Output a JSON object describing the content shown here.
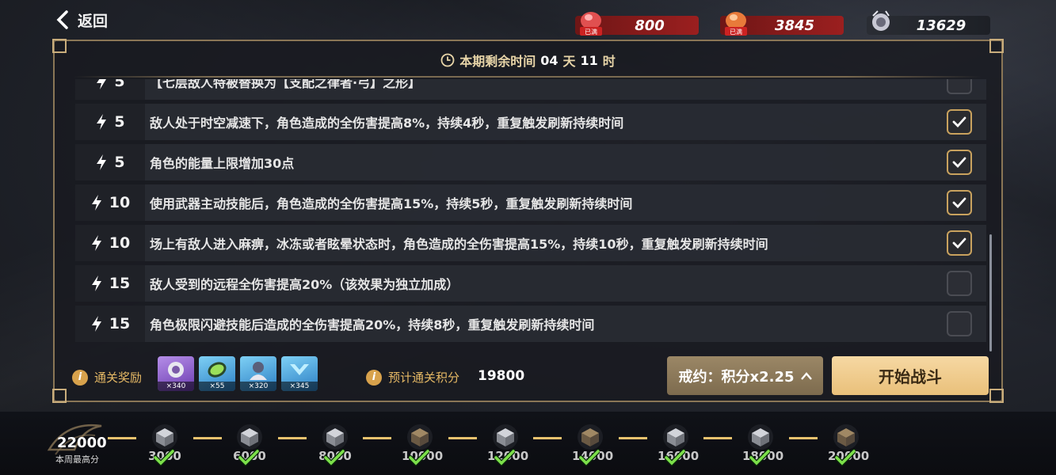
{
  "header": {
    "back_label": "返回",
    "currencies": [
      {
        "icon": "red-gem-icon",
        "badge": "已满",
        "value": "800"
      },
      {
        "icon": "orange-gem-icon",
        "badge": "已满",
        "value": "3845"
      },
      {
        "icon": "silver-badge-icon",
        "value": "13629"
      }
    ]
  },
  "timer": {
    "prefix": "本期剩余时间",
    "days": "04",
    "day_unit": "天",
    "hours": "11",
    "hour_unit": "时"
  },
  "contracts": [
    {
      "cost": "5",
      "desc": "【七层敌人特被替换为【支配之律者·弓】之形】",
      "checked": false,
      "partial": true
    },
    {
      "cost": "5",
      "desc": "敌人处于时空减速下，角色造成的全伤害提高8%，持续4秒，重复触发刷新持续时间",
      "checked": true
    },
    {
      "cost": "5",
      "desc": "角色的能量上限增加30点",
      "checked": true
    },
    {
      "cost": "10",
      "desc": "使用武器主动技能后，角色造成的全伤害提高15%，持续5秒，重复触发刷新持续时间",
      "checked": true
    },
    {
      "cost": "10",
      "desc": "场上有敌人进入麻痹，冰冻或者眩晕状态时，角色造成的全伤害提高15%，持续10秒，重复触发刷新持续时间",
      "checked": true
    },
    {
      "cost": "15",
      "desc": "敌人受到的远程全伤害提高20%（该效果为独立加成）",
      "checked": false
    },
    {
      "cost": "15",
      "desc": "角色极限闪避技能后造成的全伤害提高20%，持续8秒，重复触发刷新持续时间",
      "checked": false
    }
  ],
  "footer": {
    "reward_label": "通关奖励",
    "rewards": [
      {
        "icon": "silver-badge-icon",
        "qty": "×340"
      },
      {
        "icon": "green-crystal-icon",
        "qty": "×55"
      },
      {
        "icon": "character-token-icon",
        "qty": "×320"
      },
      {
        "icon": "blue-chevron-icon",
        "qty": "×345"
      }
    ],
    "score_label": "预计通关积分",
    "score_value": "19800",
    "pact_label": "戒约：积分x2.25",
    "start_label": "开始战斗"
  },
  "progress": {
    "best_score": "22000",
    "best_label": "本周最高分",
    "milestones": [
      {
        "label": "3000",
        "tier": "silver",
        "claimed": true
      },
      {
        "label": "6000",
        "tier": "silver",
        "claimed": true
      },
      {
        "label": "8000",
        "tier": "silver",
        "claimed": true
      },
      {
        "label": "10000",
        "tier": "bronze",
        "claimed": true
      },
      {
        "label": "12000",
        "tier": "silver",
        "claimed": true
      },
      {
        "label": "14000",
        "tier": "bronze",
        "claimed": true
      },
      {
        "label": "16000",
        "tier": "silver",
        "claimed": true
      },
      {
        "label": "18000",
        "tier": "silver",
        "claimed": true
      },
      {
        "label": "20000",
        "tier": "bronze",
        "claimed": true
      }
    ]
  },
  "colors": {
    "accent_gold": "#e6b965",
    "checkbox_gold": "#c9a25e",
    "start_button": "#f6d8a3",
    "currency_red": "#9b1f1f",
    "progress_line": "#e8c26e"
  }
}
